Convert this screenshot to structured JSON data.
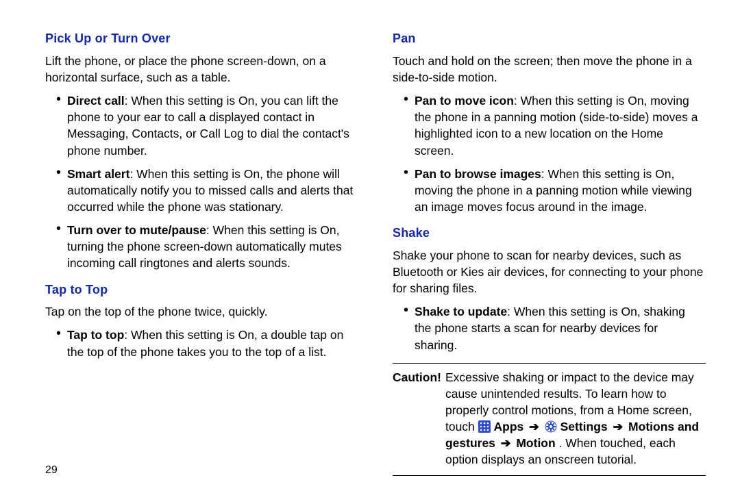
{
  "page_number": "29",
  "left": {
    "section1": {
      "heading": "Pick Up or Turn Over",
      "intro": "Lift the phone, or place the phone screen-down, on a horizontal surface, such as a table.",
      "bullets": [
        {
          "label": "Direct call",
          "text": ": When this setting is On, you can lift the phone to your ear to call a displayed contact in Messaging, Contacts, or Call Log to dial the contact's phone number."
        },
        {
          "label": "Smart alert",
          "text": ": When this setting is On, the phone will automatically notify you to missed calls and alerts that occurred while the phone was stationary."
        },
        {
          "label": "Turn over to mute/pause",
          "text": ": When this setting is On, turning the phone screen-down automatically mutes incoming call ringtones and alerts sounds."
        }
      ]
    },
    "section2": {
      "heading": "Tap to Top",
      "intro": "Tap on the top of the phone twice, quickly.",
      "bullets": [
        {
          "label": "Tap to top",
          "text": ": When this setting is On, a double tap on the top of the phone takes you to the top of a list."
        }
      ]
    }
  },
  "right": {
    "section1": {
      "heading": "Pan",
      "intro": "Touch and hold on the screen; then move the phone in a side-to-side motion.",
      "bullets": [
        {
          "label": "Pan to move icon",
          "text": ": When this setting is On, moving the phone in a panning motion (side-to-side) moves a highlighted icon to a new location on the Home screen."
        },
        {
          "label": "Pan to browse images",
          "text": ": When this setting is On, moving the phone in a panning motion while viewing an image moves focus around in the image."
        }
      ]
    },
    "section2": {
      "heading": "Shake",
      "intro": "Shake your phone to scan for nearby devices, such as Bluetooth or Kies air devices, for connecting to your phone for sharing files.",
      "bullets": [
        {
          "label": "Shake to update",
          "text": ": When this setting is On, shaking the phone starts a scan for nearby devices for sharing."
        }
      ]
    },
    "caution": {
      "label": "Caution!",
      "lead_text": "Excessive shaking or impact to the device may cause unintended results. To learn how to properly control motions, from a Home screen, touch ",
      "path_apps": "Apps",
      "path_settings": "Settings",
      "path_motions": "Motions and gestures",
      "path_motion": "Motion",
      "tail_text": ". When touched, each option displays an onscreen tutorial."
    }
  },
  "arrow": "➔"
}
